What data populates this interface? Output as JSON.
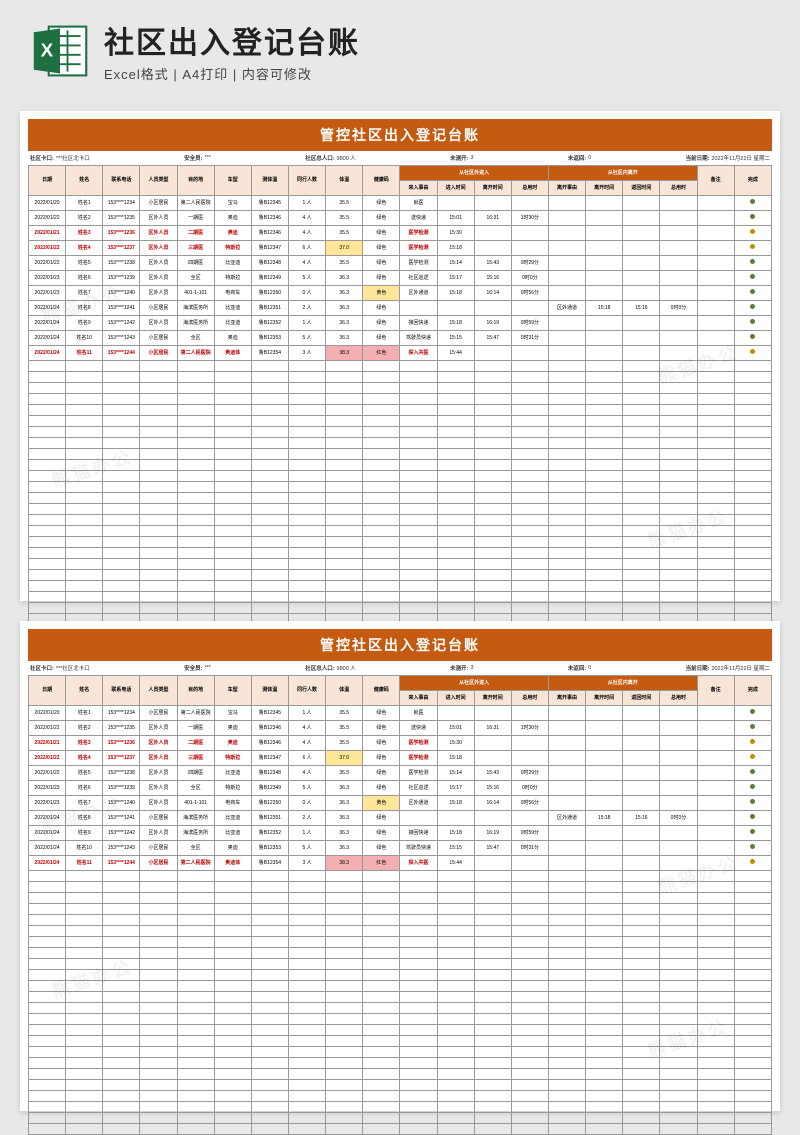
{
  "header": {
    "title": "社区出入登记台账",
    "subtitle": "Excel格式 | A4打印 | 内容可修改"
  },
  "sheet": {
    "title": "管控社区出入登记台账",
    "info": {
      "gate_lbl": "社区卡口:",
      "gate_val": "***社区北卡口",
      "guard_lbl": "安全员:",
      "guard_val": "***",
      "pop_lbl": "社区总人口:",
      "pop_val": "9800 人",
      "abn_lbl": "未测开:",
      "abn_val": "3",
      "ret_lbl": "未返回:",
      "ret_val": "0",
      "date_lbl": "当前日期:",
      "date_val": "2022年11月22日 星期二"
    },
    "cols": {
      "c1": "日期",
      "c2": "姓名",
      "c3": "联系电话",
      "c4": "人员类型",
      "c5": "目的地",
      "c6": "车型",
      "c7": "测体温",
      "c8": "同行人数",
      "c9": "体温",
      "c10": "健康码",
      "g_in": "从社区外进入",
      "c11": "来入事由",
      "c12": "进入时间",
      "c13": "离开时间",
      "c14": "总用时",
      "g_out": "从社区内离开",
      "c15": "离开事由",
      "c16": "离开时间",
      "c17": "返回时间",
      "c18": "总用时",
      "c19": "备注",
      "c20": "完成"
    },
    "rows": [
      {
        "d": "2022/01/20",
        "n": "姓名1",
        "p": "153****1234",
        "t": "小区居民",
        "dst": "第二人民医院",
        "car": "宝马",
        "mtt": "鲁B12345",
        "pp": "1 人",
        "tmp": "35.5",
        "hc": "绿色",
        "rin": "就医",
        "in1": "",
        "in2": "",
        "in3": "",
        "rout": "",
        "o1": "",
        "o2": "",
        "o3": "",
        "rm": "",
        "ok": "g"
      },
      {
        "d": "2022/01/22",
        "n": "姓名2",
        "p": "153****1235",
        "t": "区外人员",
        "dst": "一期医",
        "car": "奥迪",
        "mtt": "鲁B12346",
        "pp": "4 人",
        "tmp": "35.5",
        "hc": "绿色",
        "rin": "送快递",
        "in1": "15:01",
        "in2": "16:31",
        "in3": "1时30分",
        "rout": "",
        "o1": "",
        "o2": "",
        "o3": "",
        "rm": "",
        "ok": "g"
      },
      {
        "d": "2022/01/21",
        "n": "姓名3",
        "p": "153****1236",
        "t": "区外人员",
        "dst": "二期医",
        "car": "奥迪",
        "mtt": "鲁B12346",
        "pp": "4 人",
        "tmp": "35.5",
        "hc": "绿色",
        "rin": "医学检测",
        "in1": "15:30",
        "in2": "",
        "in3": "",
        "rout": "",
        "o1": "",
        "o2": "",
        "o3": "",
        "rm": "",
        "ok": "y",
        "red": true
      },
      {
        "d": "2022/01/22",
        "n": "姓名4",
        "p": "153****1237",
        "t": "区外人员",
        "dst": "三期医",
        "car": "特斯拉",
        "mtt": "鲁B12347",
        "pp": "6 人",
        "tmp": "37.0",
        "hc": "绿色",
        "rin": "医学检测",
        "in1": "15:18",
        "in2": "",
        "in3": "",
        "rout": "",
        "o1": "",
        "o2": "",
        "o3": "",
        "rm": "",
        "ok": "y",
        "red": true,
        "tmpHl": "y"
      },
      {
        "d": "2022/01/22",
        "n": "姓名5",
        "p": "153****1238",
        "t": "区外人员",
        "dst": "四期医",
        "car": "比亚迪",
        "mtt": "鲁B12348",
        "pp": "4 人",
        "tmp": "35.5",
        "hc": "绿色",
        "rin": "医学检测",
        "in1": "15:14",
        "in2": "15:43",
        "in3": "0时29分",
        "rout": "",
        "o1": "",
        "o2": "",
        "o3": "",
        "rm": "",
        "ok": "g"
      },
      {
        "d": "2022/01/23",
        "n": "姓名6",
        "p": "153****1239",
        "t": "区外人员",
        "dst": "全区",
        "car": "特斯拉",
        "mtt": "鲁B12349",
        "pp": "5 人",
        "tmp": "36.3",
        "hc": "绿色",
        "rin": "社区巡逻",
        "in1": "15:17",
        "in2": "15:16",
        "in3": "0时0分",
        "rout": "",
        "o1": "",
        "o2": "",
        "o3": "",
        "rm": "",
        "ok": "g"
      },
      {
        "d": "2022/01/23",
        "n": "姓名7",
        "p": "153****1240",
        "t": "区外人员",
        "dst": "401-1-101",
        "car": "电商车",
        "mtt": "鲁B12350",
        "pp": "0 人",
        "tmp": "36.3",
        "hc": "黄色",
        "rin": "区外通道",
        "in1": "15:18",
        "in2": "16:14",
        "in3": "0时56分",
        "rout": "",
        "o1": "",
        "o2": "",
        "o3": "",
        "rm": "",
        "ok": "g",
        "hcHl": "y"
      },
      {
        "d": "2022/01/24",
        "n": "姓名8",
        "p": "153****1241",
        "t": "小区居民",
        "dst": "海滨医务所",
        "car": "比亚迪",
        "mtt": "鲁B12351",
        "pp": "2 人",
        "tmp": "36.3",
        "hc": "绿色",
        "rin": "",
        "in1": "",
        "in2": "",
        "in3": "",
        "rout": "区外通道",
        "o1": "15:18",
        "o2": "15:16",
        "o3": "0时0分",
        "rm": "",
        "ok": "g"
      },
      {
        "d": "2022/01/24",
        "n": "姓名9",
        "p": "153****1242",
        "t": "区外人员",
        "dst": "海滨医务所",
        "car": "比亚迪",
        "mtt": "鲁B12352",
        "pp": "1 人",
        "tmp": "36.3",
        "hc": "绿色",
        "rin": "接回快递",
        "in1": "15:18",
        "in2": "16:19",
        "in3": "0时59分",
        "rout": "",
        "o1": "",
        "o2": "",
        "o3": "",
        "rm": "",
        "ok": "g"
      },
      {
        "d": "2022/01/24",
        "n": "姓名10",
        "p": "153****1243",
        "t": "小区居民",
        "dst": "全区",
        "car": "奥迪",
        "mtt": "鲁B12353",
        "pp": "5 人",
        "tmp": "36.3",
        "hc": "绿色",
        "rin": "驾驶员快递",
        "in1": "15:15",
        "in2": "15:47",
        "in3": "0时31分",
        "rout": "",
        "o1": "",
        "o2": "",
        "o3": "",
        "rm": "",
        "ok": "g"
      },
      {
        "d": "2022/01/24",
        "n": "姓名11",
        "p": "153****1244",
        "t": "小区居民",
        "dst": "第二人民医院",
        "car": "奥迪体",
        "mtt": "鲁B12354",
        "pp": "3 人",
        "tmp": "38.3",
        "hc": "红色",
        "rin": "探入共医",
        "in1": "15:44",
        "in2": "",
        "in3": "",
        "rout": "",
        "o1": "",
        "o2": "",
        "o3": "",
        "rm": "",
        "ok": "y",
        "red": true,
        "tmpHl": "r",
        "hcHl": "r"
      }
    ],
    "blankRows": 24
  },
  "watermark": "熊猫办公"
}
